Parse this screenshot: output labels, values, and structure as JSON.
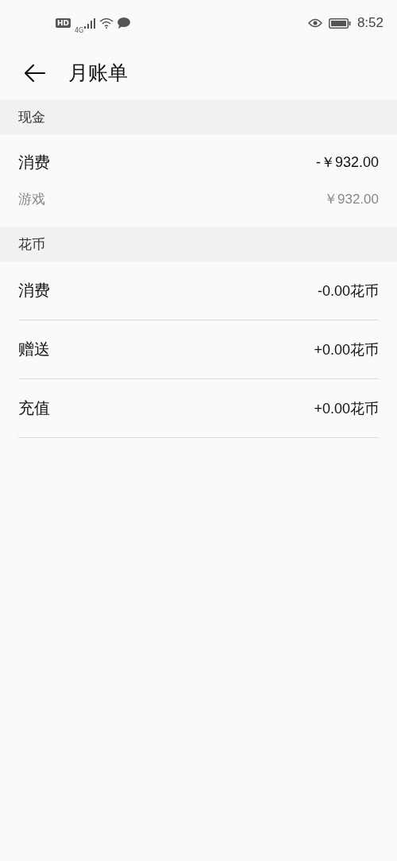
{
  "status_bar": {
    "hd": "HD",
    "network": "4G",
    "time": "8:52"
  },
  "header": {
    "title": "月账单"
  },
  "sections": [
    {
      "title": "现金",
      "divided": false,
      "rows": [
        {
          "kind": "main",
          "label": "消费",
          "amount": "-￥932.00"
        },
        {
          "kind": "sub",
          "label": "游戏",
          "amount": "￥932.00"
        }
      ]
    },
    {
      "title": "花币",
      "divided": true,
      "rows": [
        {
          "kind": "main",
          "label": "消费",
          "amount": "-0.00花币"
        },
        {
          "kind": "main",
          "label": "赠送",
          "amount": "+0.00花币"
        },
        {
          "kind": "main",
          "label": "充值",
          "amount": "+0.00花币"
        }
      ]
    }
  ]
}
